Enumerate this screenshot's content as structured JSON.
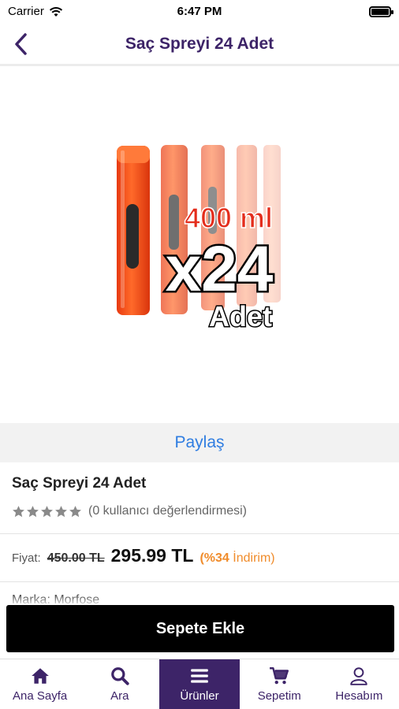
{
  "status": {
    "carrier": "Carrier",
    "time": "6:47 PM"
  },
  "nav": {
    "title": "Saç Spreyi 24 Adet",
    "back_icon": "chevron-left-icon"
  },
  "hero": {
    "volume_text": "400 ml",
    "multiplier_text": "x24",
    "unit_text": "Adet"
  },
  "share": {
    "label": "Paylaş"
  },
  "product": {
    "title": "Saç Spreyi 24 Adet",
    "rating": 0,
    "rating_max": 5,
    "rating_text": "(0 kullanıcı değerlendirmesi)"
  },
  "price": {
    "label": "Fiyat:",
    "old": "450.00 TL",
    "new": "295.99 TL",
    "discount_pct": "(%34",
    "discount_word": "İndirim)"
  },
  "brand": {
    "text": "Marka: Morfose"
  },
  "cart_button": {
    "label": "Sepete Ekle"
  },
  "tabs": [
    {
      "label": "Ana Sayfa",
      "icon": "home-icon",
      "active": false
    },
    {
      "label": "Ara",
      "icon": "search-icon",
      "active": false
    },
    {
      "label": "Ürünler",
      "icon": "menu-icon",
      "active": true
    },
    {
      "label": "Sepetim",
      "icon": "cart-icon",
      "active": false
    },
    {
      "label": "Hesabım",
      "icon": "user-icon",
      "active": false
    }
  ],
  "colors": {
    "brand": "#3d2468",
    "link": "#2f7de1",
    "discount": "#f08c2b",
    "star": "#8a8a8a"
  }
}
